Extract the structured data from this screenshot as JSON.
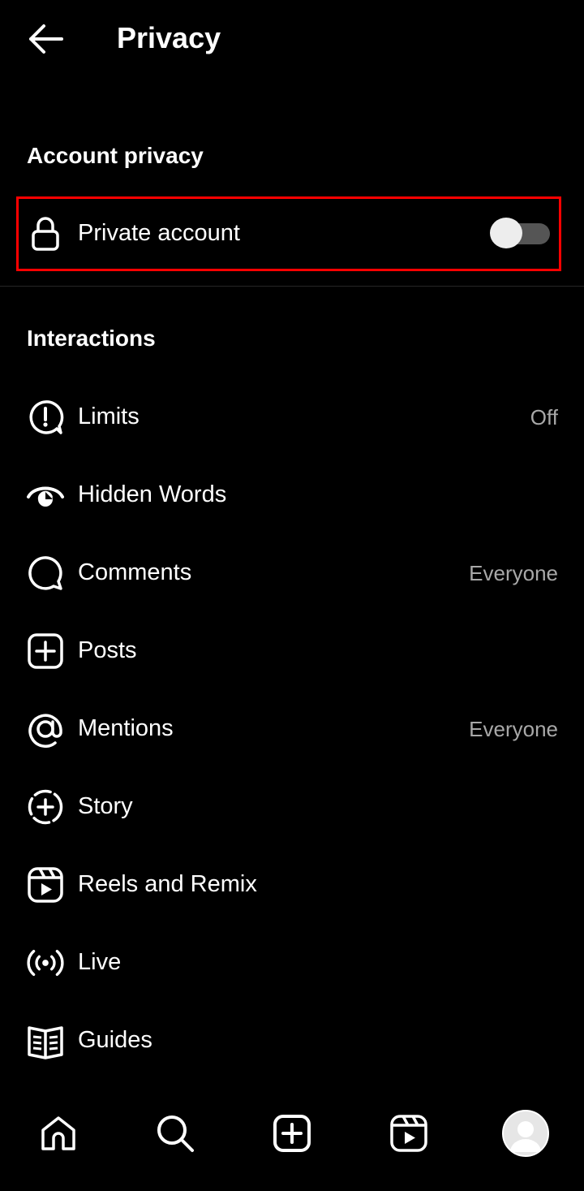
{
  "header": {
    "title": "Privacy",
    "back_icon": "arrow-left-icon"
  },
  "sections": {
    "account_privacy": {
      "heading": "Account privacy",
      "private_account": {
        "label": "Private account",
        "icon": "lock-icon",
        "toggle_on": false
      }
    },
    "interactions": {
      "heading": "Interactions",
      "items": [
        {
          "label": "Limits",
          "value": "Off",
          "icon": "limits-icon"
        },
        {
          "label": "Hidden Words",
          "value": "",
          "icon": "hidden-words-icon"
        },
        {
          "label": "Comments",
          "value": "Everyone",
          "icon": "comment-icon"
        },
        {
          "label": "Posts",
          "value": "",
          "icon": "post-add-icon"
        },
        {
          "label": "Mentions",
          "value": "Everyone",
          "icon": "at-icon"
        },
        {
          "label": "Story",
          "value": "",
          "icon": "story-add-icon"
        },
        {
          "label": "Reels and Remix",
          "value": "",
          "icon": "reels-icon"
        },
        {
          "label": "Live",
          "value": "",
          "icon": "live-icon"
        },
        {
          "label": "Guides",
          "value": "",
          "icon": "guides-icon"
        }
      ]
    }
  },
  "bottom_nav": {
    "items": [
      "home-icon",
      "search-icon",
      "create-icon",
      "reels-icon",
      "profile-avatar"
    ]
  },
  "colors": {
    "background": "#000000",
    "text": "#ffffff",
    "secondary_text": "#a8a8a8",
    "highlight": "#ff0000",
    "toggle_track": "#555555",
    "toggle_knob": "#ededed"
  }
}
